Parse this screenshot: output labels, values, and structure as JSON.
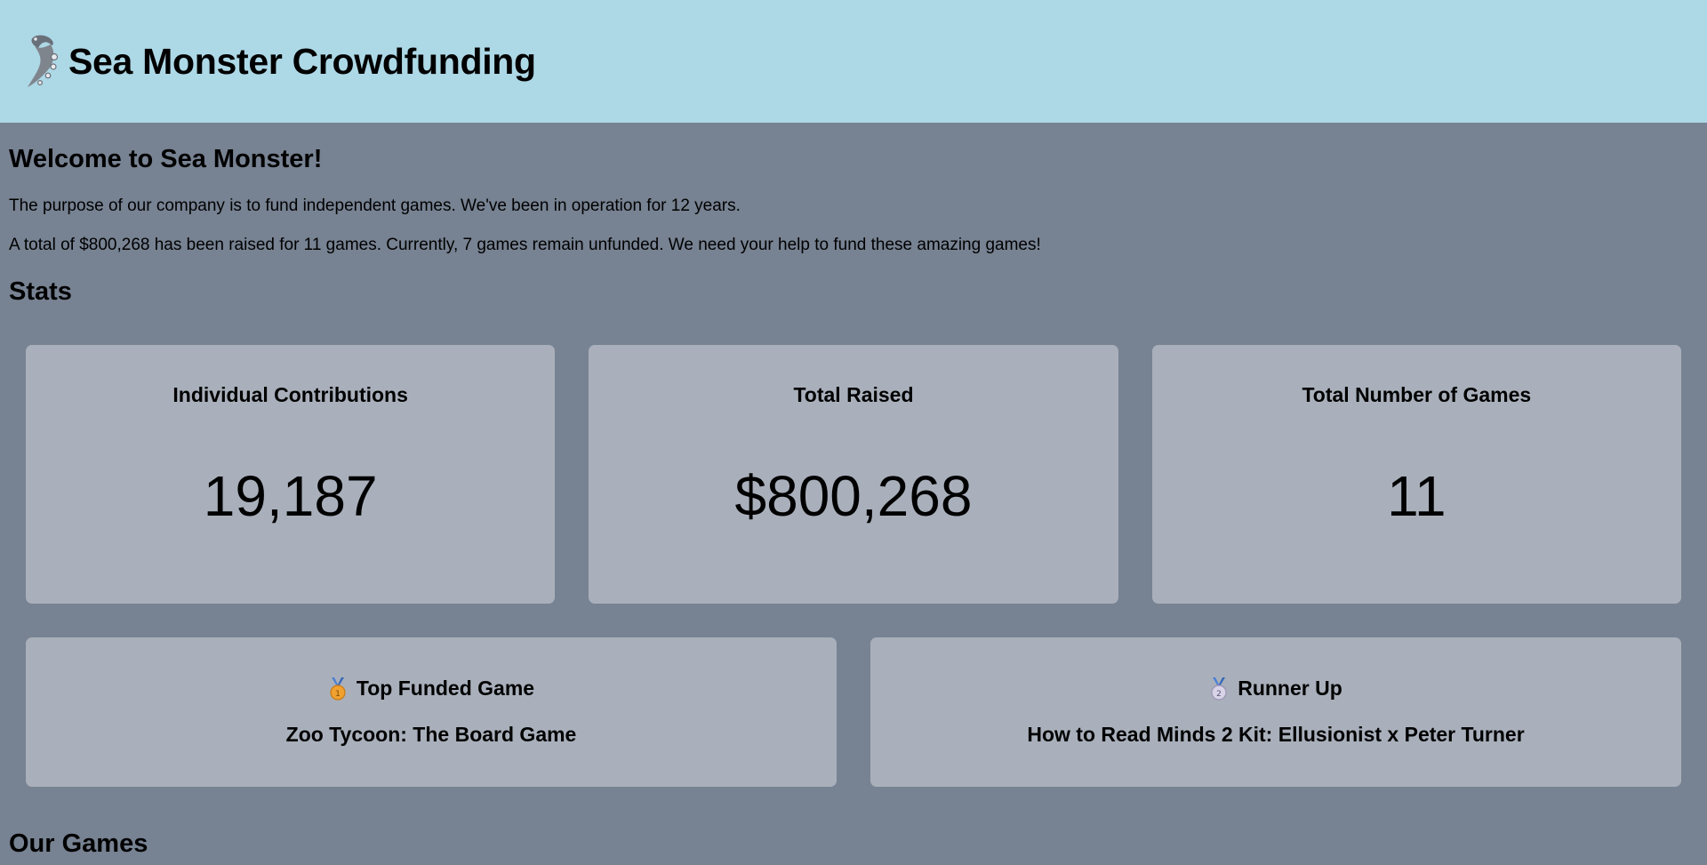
{
  "header": {
    "title": "Sea Monster Crowdfunding",
    "logo_icon": "tentacle-logo-icon"
  },
  "welcome": {
    "title": "Welcome to Sea Monster!",
    "description": "The purpose of our company is to fund independent games. We've been in operation for 12 years.",
    "summary": "A total of $800,268 has been raised for 11 games. Currently, 7 games remain unfunded. We need your help to fund these amazing games!"
  },
  "stats": {
    "title": "Stats",
    "cards": [
      {
        "label": "Individual Contributions",
        "value": "19,187"
      },
      {
        "label": "Total Raised",
        "value": "$800,268"
      },
      {
        "label": "Total Number of Games",
        "value": "11"
      }
    ]
  },
  "top_games": [
    {
      "label": "Top Funded Game",
      "icon": "gold-medal-icon",
      "game": "Zoo Tycoon: The Board Game"
    },
    {
      "label": "Runner Up",
      "icon": "silver-medal-icon",
      "game": "How to Read Minds 2 Kit: Ellusionist x Peter Turner"
    }
  ],
  "games_section": {
    "title": "Our Games"
  },
  "colors": {
    "header_bg": "#add8e6",
    "page_bg": "#778292",
    "card_bg": "#a9b0bb"
  }
}
